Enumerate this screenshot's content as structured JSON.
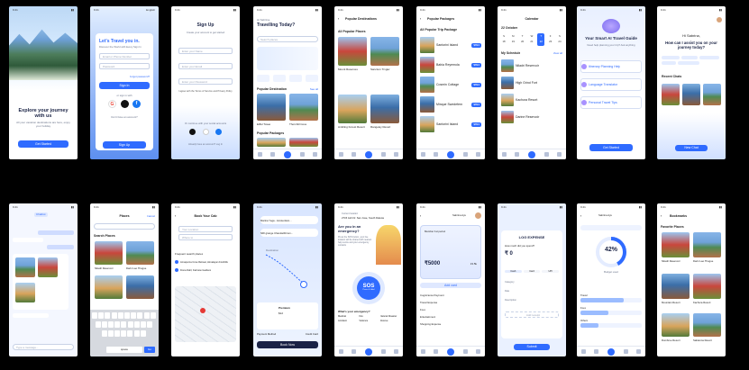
{
  "colors": {
    "primary": "#2f6bff",
    "navy": "#1a2345",
    "sky": "#dce8ff"
  },
  "screens": {
    "onboarding": {
      "title": "Explore your journey with us",
      "subtitle": "All your vacation destinations are here, enjoy your holiday",
      "cta": "Get Started",
      "time": "9:41"
    },
    "login": {
      "title": "Let's Travel you in.",
      "subtitle": "Discover the World with Every Sign In",
      "email_ph": "Email or Phone Number",
      "pass_ph": "Password",
      "forgot": "Forgot password?",
      "signin": "Sign In",
      "or": "or sign in with",
      "noaccount": "Don't have an account?",
      "signup": "Sign Up",
      "lang": "English"
    },
    "signup": {
      "title": "Sign Up",
      "subtitle": "Create your account to get started",
      "f1": "Enter your Name",
      "f2": "Enter your Email",
      "f3": "Enter your Password",
      "terms": "I agree with the Terms of Service and Privacy Policy",
      "or": "Or continue with your social accounts",
      "btn": "Sign Up",
      "foot": "Already have an account? Log In"
    },
    "home": {
      "greeting": "Hi Sabrina,",
      "title": "Travelling Today?",
      "search": "Search places",
      "section": "Popular Destination",
      "seeall": "See all",
      "place1": "Eiffel Tower",
      "place2": "Thornhill Cove",
      "packages": "Popular Packages"
    },
    "destinations": {
      "title": "Popular Destinations",
      "section": "All Popular Places",
      "p1": "Mount Reserves",
      "p2": "Sanctum Trvgiw",
      "p3": "Ambling Forest Resort",
      "p4": "Rangeley Resort"
    },
    "packages": {
      "title": "Popular Packages",
      "section": "All Popular Trip Package",
      "k1": "Santorini Island",
      "k2": "Bahia Reyemola",
      "k3": "Cosmin Cottage",
      "k4": "Minque Swedefern",
      "price": "$894"
    },
    "calendar": {
      "title": "Calendar",
      "month": "22 October",
      "schedule": "My Schedule",
      "viewall": "View all",
      "e1": "Niladri Reservoir",
      "e2": "High Grind Fort",
      "e3": "Kachura Resort",
      "e4": "Darine Reservoir",
      "days": [
        "S",
        "M",
        "T",
        "W",
        "T",
        "F",
        "S"
      ],
      "dates": [
        "18",
        "19",
        "20",
        "21",
        "22",
        "23",
        "24"
      ]
    },
    "guide": {
      "title": "Your Smart AI Travel Guide",
      "subtitle": "Need help planning your trip? Ask anything",
      "o1": "Itinerary Planning Help",
      "o2": "Language Translator",
      "o3": "Personal Travel Tips",
      "cta": "Get Started"
    },
    "assistant": {
      "greeting": "Hi Sabrina,",
      "title": "How can I assist you on your journey today?",
      "recent": "Recent Chats",
      "newchat": "New Chat"
    },
    "chat": {
      "title": "Chatbot",
      "input": "Type a message..."
    },
    "places": {
      "title": "Places",
      "cancel": "Cancel",
      "section": "Search Places",
      "p1": "Niladri Reservoir",
      "p2": "Darin Lao Thugue",
      "p3": "Mountain Reserve",
      "p4": "Kachura Resort",
      "spacebar": "space",
      "go": "Go"
    },
    "cab": {
      "title": "Book Your Cab",
      "from": "Your Location",
      "to": "Where to",
      "recent": "Frequent search places",
      "r1": "Annapurna Cove Retreat, Himalayan Foothills",
      "r2": "Fiona Dahl, Fairview Gardens"
    },
    "route": {
      "c1": "Marina Yoga - Amsterdam...",
      "c2": "NRI grange Chandarbhrom...",
      "dest": "Destination",
      "car": "Premium",
      "fare": "$12",
      "pay": "Payment Method",
      "cash": "Credit Card",
      "book": "Book Now"
    },
    "sos": {
      "loc": "Current location",
      "addr": "2715 Ash Dr. San Jose, South Dakota",
      "title": "Are you in an emergency?",
      "desc": "Press the SOS button, your live location will be shared with nearest help centre and your emergency contacts",
      "btn": "SOS",
      "sub": "Press & Hold",
      "q": "What's your emergency?",
      "e1": "Medical",
      "e2": "Fire",
      "e3": "Natural Disaster",
      "e4": "Accident",
      "e5": "Violence",
      "e6": "Rescue"
    },
    "wallet": {
      "name": "Sabrina Ayu",
      "label": "Member 1st period",
      "amount": "₹5000",
      "sub": "23.5k",
      "addcard": "Add card",
      "t1": "Cognizance Payment",
      "t2": "Travel Expense",
      "t3": "Food",
      "t4": "Entertainment",
      "t5": "Shopping Expense"
    },
    "expense": {
      "title": "LOG EXPENSE",
      "q": "How much did you spend?",
      "amount": "₹ 0",
      "tab1": "Cash",
      "tab2": "Card",
      "tab3": "UPI",
      "cat": "Category",
      "date": "Date",
      "desc": "Description",
      "receipt": "Add receipt",
      "submit": "Submit"
    },
    "budget": {
      "name": "Sabrina Ayu",
      "pct": "42%",
      "label": "Budget used",
      "b1": "Travel",
      "b2": "Food",
      "b3": "Others",
      "progress": 0.42
    },
    "bookmarks": {
      "title": "Bookmarks",
      "section": "Favorite Places",
      "p1": "Niladri Reservoir",
      "p2": "Darin Lao Thugue",
      "p3": "Mountain Resort",
      "p4": "Kachura Resort",
      "p5": "Rumbrue Resort",
      "p6": "Sabianna Resort"
    }
  }
}
